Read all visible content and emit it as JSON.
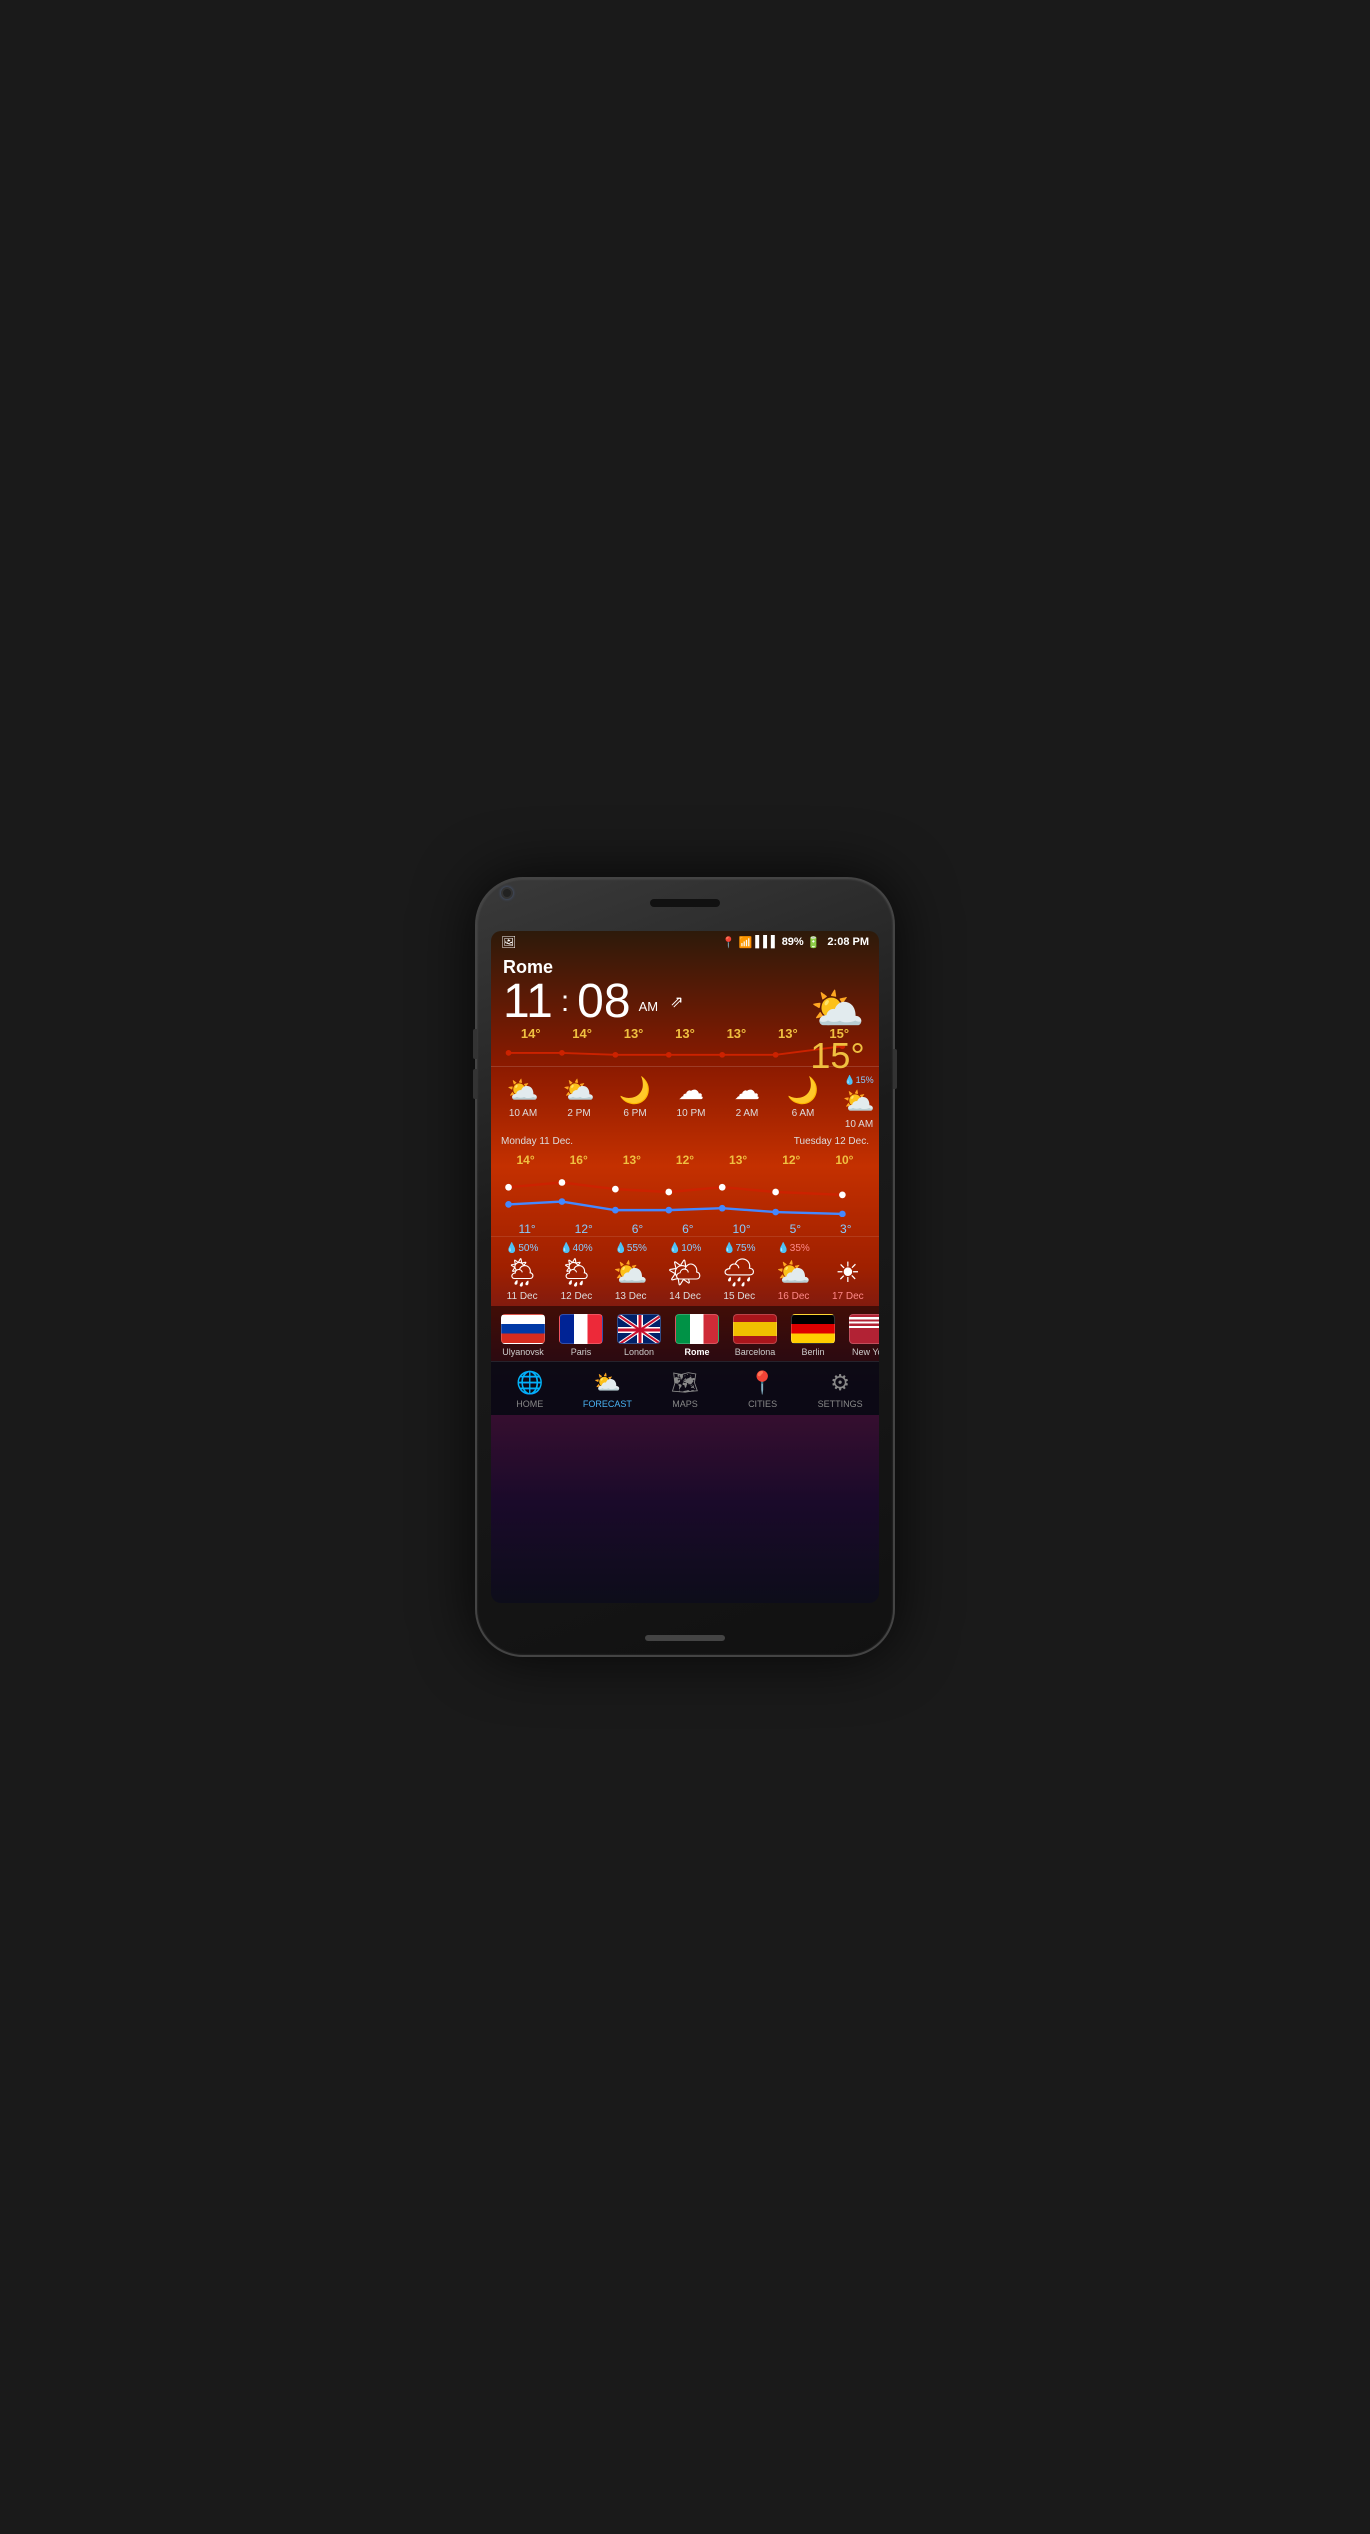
{
  "statusBar": {
    "location": "📍",
    "wifi": "wifi",
    "signal": "▌▌▌",
    "battery": "89%",
    "time": "2:08 PM"
  },
  "weather": {
    "city": "Rome",
    "time": "11",
    "timeMinutes": "08",
    "timeAmPm": "AM",
    "currentTemp": "15°",
    "currentIcon": "⛅",
    "tempHigh": "15°"
  },
  "hourlyTemps": [
    "14°",
    "14°",
    "13°",
    "13°",
    "13°",
    "13°",
    "15°"
  ],
  "hourly": [
    {
      "icon": "⛅",
      "time": "10 AM",
      "day": ""
    },
    {
      "icon": "⛅",
      "time": "2 PM",
      "day": ""
    },
    {
      "icon": "🌙",
      "time": "6 PM",
      "day": ""
    },
    {
      "icon": "☁",
      "time": "10 PM",
      "day": ""
    },
    {
      "icon": "☁",
      "time": "2 AM",
      "day": ""
    },
    {
      "icon": "🌙",
      "time": "6 AM",
      "day": ""
    },
    {
      "icon": "⛅",
      "time": "10 AM",
      "day": "💧15%"
    }
  ],
  "dateLabels": {
    "left": "Monday 11 Dec.",
    "right": "Tuesday 12 Dec."
  },
  "dailyHighTemps": [
    "14°",
    "16°",
    "13°",
    "12°",
    "13°",
    "12°",
    "10°"
  ],
  "dailyLowTemps": [
    "11°",
    "12°",
    "6°",
    "6°",
    "10°",
    "5°",
    "3°"
  ],
  "dailyCards": [
    {
      "precip": "50%",
      "icon": "🌦",
      "date": "11 Dec"
    },
    {
      "precip": "40%",
      "icon": "🌦",
      "date": "12 Dec"
    },
    {
      "precip": "55%",
      "icon": "⛅",
      "date": "13 Dec"
    },
    {
      "precip": "10%",
      "icon": "🌤",
      "date": "14 Dec"
    },
    {
      "precip": "75%",
      "icon": "🌧",
      "date": "15 Dec"
    },
    {
      "precip": "35%",
      "icon": "⛅",
      "date": "16 Dec"
    },
    {
      "precip": "",
      "icon": "☀",
      "date": "17 Dec"
    }
  ],
  "cities": [
    {
      "flag": "russia",
      "label": "Ulyanovsk",
      "active": false
    },
    {
      "flag": "france",
      "label": "Paris",
      "active": false
    },
    {
      "flag": "uk",
      "label": "London",
      "active": false
    },
    {
      "flag": "italy",
      "label": "Rome",
      "active": true
    },
    {
      "flag": "spain",
      "label": "Barcelona",
      "active": false
    },
    {
      "flag": "germany",
      "label": "Berlin",
      "active": false
    },
    {
      "flag": "usa",
      "label": "New York",
      "active": false
    }
  ],
  "nav": [
    {
      "icon": "🌐",
      "label": "HOME",
      "active": false
    },
    {
      "icon": "⛅",
      "label": "FORECAST",
      "active": true
    },
    {
      "icon": "🗺",
      "label": "MAPS",
      "active": false
    },
    {
      "icon": "📍",
      "label": "CITIES",
      "active": false
    },
    {
      "icon": "⚙",
      "label": "SETTINGS",
      "active": false
    }
  ]
}
